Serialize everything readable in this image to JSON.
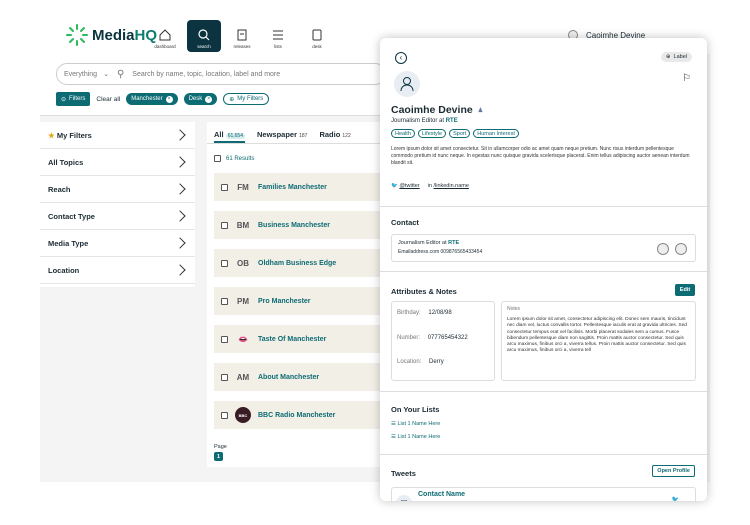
{
  "logo": {
    "part1": "Media",
    "part2": "HQ"
  },
  "nav": [
    {
      "label": "dashboard",
      "icon": "home-icon"
    },
    {
      "label": "search",
      "icon": "search-icon"
    },
    {
      "label": "releases",
      "icon": "releases-icon"
    },
    {
      "label": "lists",
      "icon": "lists-icon"
    },
    {
      "label": "desk",
      "icon": "desk-icon"
    }
  ],
  "user": {
    "name": "Caoimhe Devine"
  },
  "search": {
    "scope": "Everything",
    "placeholder": "Search by name, topic, location, label and more"
  },
  "filters": {
    "filters_label": "Filters",
    "clear_label": "Clear all",
    "chips": [
      "Manchester",
      "Desk"
    ],
    "my_filters": "My Filters"
  },
  "sidebar": [
    "My Filters",
    "All Topics",
    "Reach",
    "Contact Type",
    "Media Type",
    "Location"
  ],
  "tabs": [
    {
      "label": "All",
      "count": "61,654"
    },
    {
      "label": "Newspaper",
      "count": "187"
    },
    {
      "label": "Radio",
      "count": "122"
    }
  ],
  "results_count": "61 Results",
  "results": [
    {
      "initials": "FM",
      "name": "Families Manchester"
    },
    {
      "initials": "BM",
      "name": "Business Manchester"
    },
    {
      "initials": "OB",
      "name": "Oldham Business Edge"
    },
    {
      "initials": "PM",
      "name": "Pro Manchester"
    },
    {
      "initials": "",
      "name": "Taste Of Manchester"
    },
    {
      "initials": "AM",
      "name": "About Manchester"
    },
    {
      "initials": "",
      "name": "BBC Radio Manchester"
    }
  ],
  "page": {
    "label": "Page",
    "num": "1"
  },
  "panel": {
    "label_btn": "Label",
    "name": "Caoimhe Devine",
    "role": "Journalism Editor at",
    "org": "RTE",
    "tags": [
      "Health",
      "Lifestyle",
      "Sport",
      "Human Interest"
    ],
    "bio": "Lorem ipsum dolor sit amet consectetur. Sit in ullamcorper odio ac amet quam neque pretium. Nunc risus interdum pellentesque commodo pretium id nunc neque. In egestas nunc quisque gravida scelerisque placerat. Enim tellus adipiscing auctor aenean interdum blandit sit.",
    "twitter": "@twitter",
    "linkedin": "/linkedin.name",
    "contact": {
      "title": "Contact",
      "role": "Journalism Editor at",
      "org": "RTE",
      "email": "Emailaddress.com",
      "phone": "009876565433454"
    },
    "attrs": {
      "title": "Attributes & Notes",
      "edit": "Edit",
      "birthday_label": "Birthday:",
      "birthday": "12/08/98",
      "number_label": "Number:",
      "number": "077765454322",
      "location_label": "Location:",
      "location": "Derry",
      "notes_label": "Notes",
      "notes": "Lorem ipsum dolor sit amet, consectetur adipiscing elit. Donec sem mauris, tincidunt nec diam vel, luctus convallis tortor. Pellentesque iaculis erat at gravida ultricies. Sed consectetur tempus erat vel facilisis. Morbi placerat sodales sem a cursus. Fusce bibendum pellentesque diam non sagittis. Proin mattis auctor consectetur. Sed quis arcu maximus, finibus orci a, viverra tellus. Proin mattis auctor consectetur. Sed quis arcu maximus, finibus orci a, viverra tell"
    },
    "lists": {
      "title": "On Your Lists",
      "items": [
        "List 1 Name Here",
        "List 1 Name Here"
      ]
    },
    "tweets": {
      "title": "Tweets",
      "open": "Open Profile",
      "contact": "Contact Name",
      "initials": "CD"
    }
  },
  "colors": {
    "teal": "#0d6b73",
    "navy": "#0b3340"
  }
}
